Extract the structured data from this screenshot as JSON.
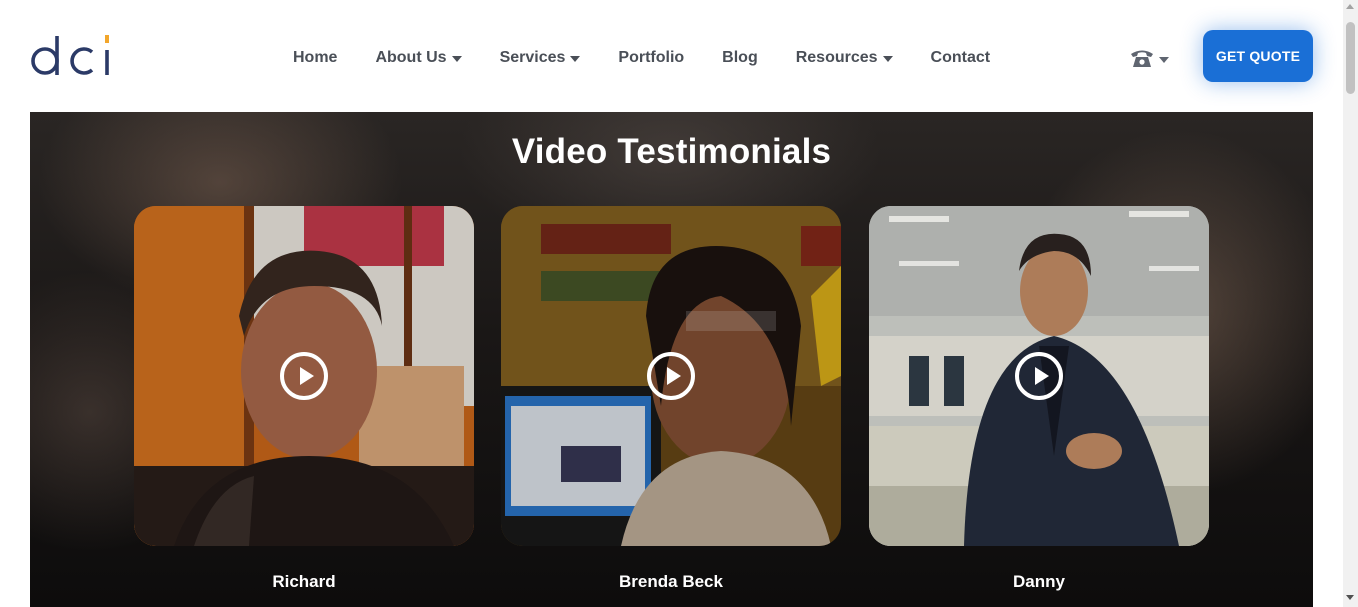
{
  "logo": {
    "text": "dci",
    "colors": {
      "letters": "#2b3a67",
      "accent": "#f2a62b"
    }
  },
  "nav": {
    "items": [
      {
        "label": "Home",
        "dropdown": false
      },
      {
        "label": "About Us",
        "dropdown": true
      },
      {
        "label": "Services",
        "dropdown": true
      },
      {
        "label": "Portfolio",
        "dropdown": false
      },
      {
        "label": "Blog",
        "dropdown": false
      },
      {
        "label": "Resources",
        "dropdown": true
      },
      {
        "label": "Contact",
        "dropdown": false
      }
    ],
    "phone_icon": "phone-icon",
    "cta_label": "GET QUOTE",
    "cta_color": "#1a6fd6"
  },
  "hero": {
    "title": "Video Testimonials",
    "videos": [
      {
        "name": "Richard",
        "icon": "play-icon"
      },
      {
        "name": "Brenda Beck",
        "icon": "play-icon"
      },
      {
        "name": "Danny",
        "icon": "play-icon"
      }
    ]
  }
}
